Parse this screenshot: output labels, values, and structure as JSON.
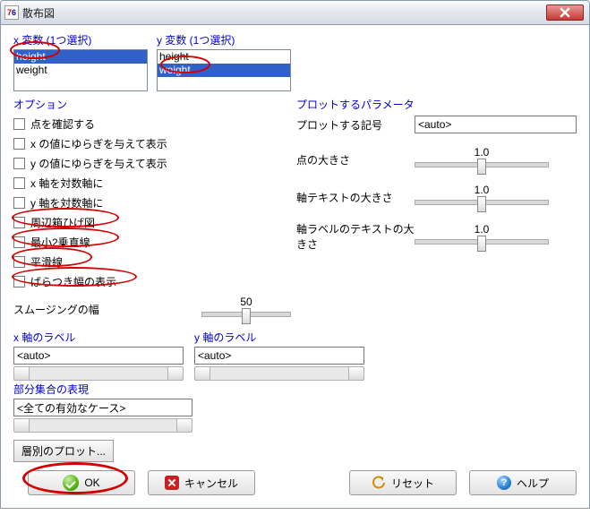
{
  "window": {
    "title": "散布図"
  },
  "x_var": {
    "label": "x 変数 (1つ選択)",
    "items": [
      "height",
      "weight"
    ],
    "selected": "height"
  },
  "y_var": {
    "label": "y 変数 (1つ選択)",
    "items": [
      "height",
      "weight"
    ],
    "selected": "weight"
  },
  "options": {
    "heading": "オプション",
    "items": [
      "点を確認する",
      "x の値にゆらぎを与えて表示",
      "y の値にゆらぎを与えて表示",
      "x 軸を対数軸に",
      "y 軸を対数軸に",
      "周辺箱ひげ図",
      "最小2乗直線",
      "平滑線",
      "ばらつき幅の表示"
    ]
  },
  "plot_params": {
    "heading": "プロットするパラメータ",
    "symbol_label": "プロットする記号",
    "symbol_value": "<auto>",
    "point_size_label": "点の大きさ",
    "point_size_value": "1.0",
    "axis_text_label": "軸テキストの大きさ",
    "axis_text_value": "1.0",
    "axis_label_text_label": "軸ラベルのテキストの大きさ",
    "axis_label_text_value": "1.0"
  },
  "smoothing": {
    "label": "スムージングの幅",
    "value": "50"
  },
  "xlab": {
    "label": "x 軸のラベル",
    "value": "<auto>"
  },
  "ylab": {
    "label": "y 軸のラベル",
    "value": "<auto>"
  },
  "subset": {
    "heading": "部分集合の表現",
    "value": "<全ての有効なケース>",
    "plot_by_group": "層別のプロット..."
  },
  "buttons": {
    "ok": "OK",
    "cancel": "キャンセル",
    "reset": "リセット",
    "help": "ヘルプ"
  }
}
